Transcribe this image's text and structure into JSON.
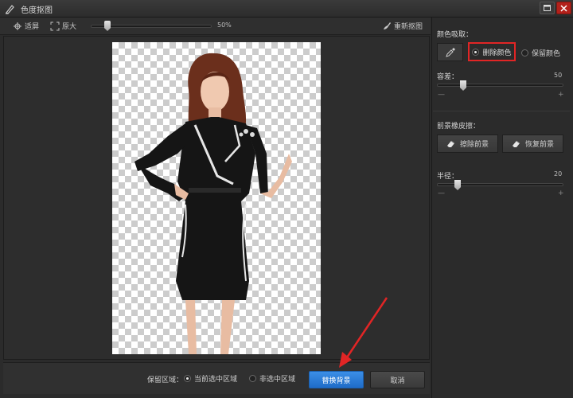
{
  "window": {
    "title": "色度抠图"
  },
  "toolbar": {
    "fit_label": "适屏",
    "original_label": "原大",
    "zoom_value": "50%",
    "zoom_fraction": 0.15,
    "rematte_label": "重新抠图"
  },
  "sidebar": {
    "color_pick_title": "颜色吸取：",
    "delete_color_label": "删除颜色",
    "keep_color_label": "保留颜色",
    "delete_color_selected": true,
    "tolerance_label": "容差：",
    "tolerance_value": "50",
    "tolerance_fraction": 0.2,
    "fg_eraser_title": "前景橡皮擦：",
    "erase_fg_label": "擦除前景",
    "restore_fg_label": "恢复前景",
    "radius_label": "半径：",
    "radius_value": "20",
    "radius_fraction": 0.16,
    "minus": "—",
    "plus": "+"
  },
  "footer": {
    "keep_region_label": "保留区域：",
    "current_region_label": "当前选中区域",
    "non_region_label": "非选中区域",
    "current_region_selected": true,
    "replace_bg_label": "替换背景",
    "cancel_label": "取消"
  },
  "colors": {
    "accent_blue": "#2a7bd8",
    "highlight_red": "#e12525",
    "close_red": "#b3211b"
  },
  "icons": {
    "app": "chroma-key-icon",
    "maximize": "maximize-icon",
    "close": "close-icon",
    "fit": "fit-screen-icon",
    "original": "original-size-icon",
    "rematte": "brush-icon",
    "picker": "eyedropper-icon",
    "eraser": "eraser-icon"
  }
}
